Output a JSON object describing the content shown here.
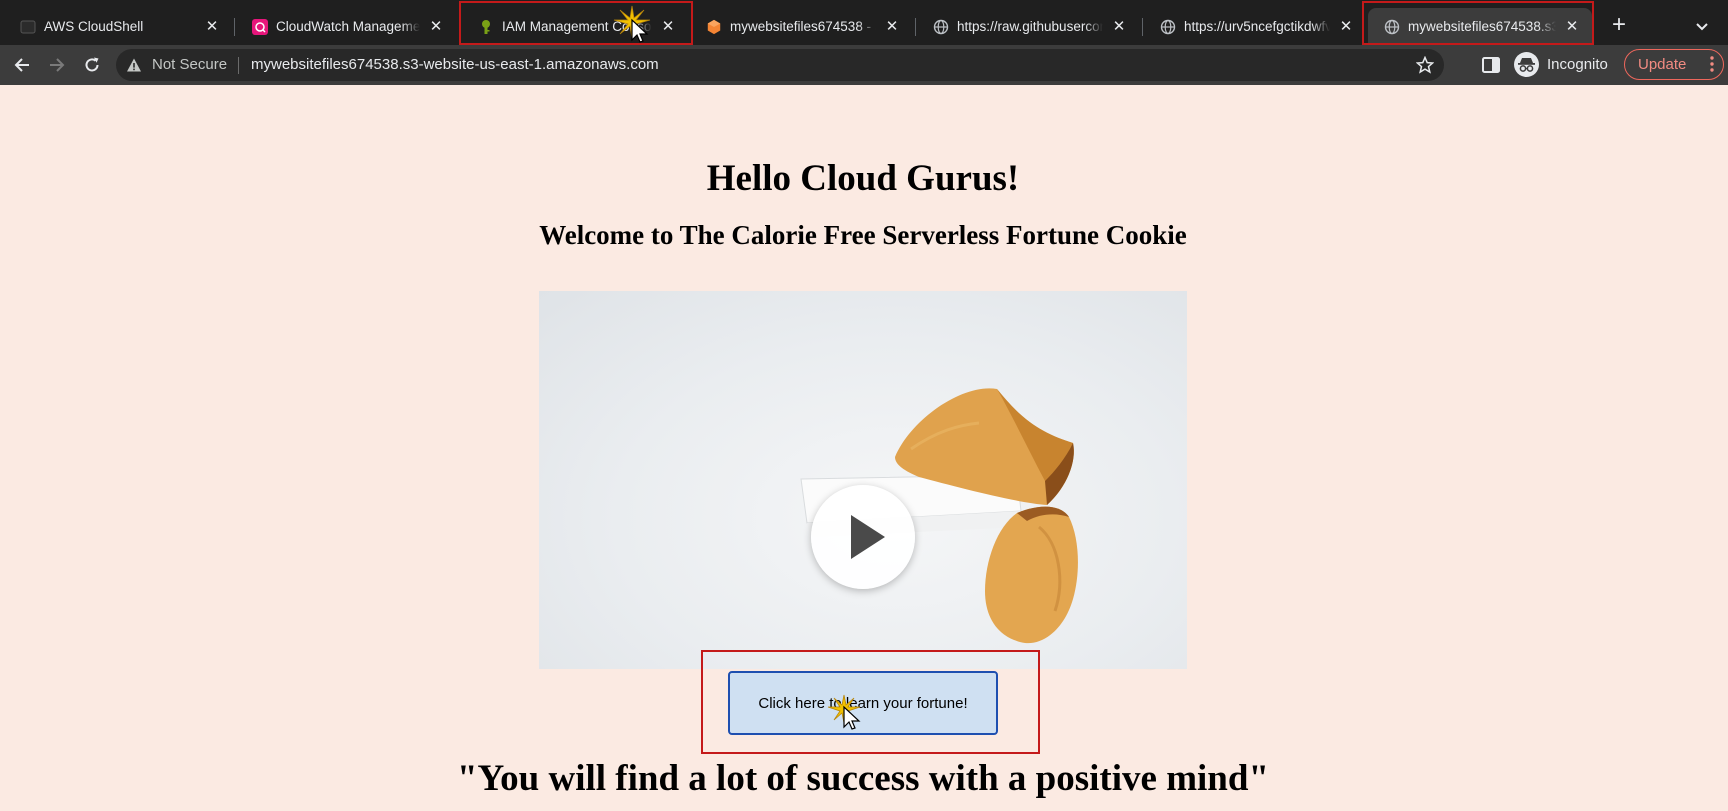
{
  "tabs": [
    {
      "title": "AWS CloudShell",
      "favicon": "cloudshell-icon"
    },
    {
      "title": "CloudWatch Management C",
      "favicon": "cloudwatch-icon"
    },
    {
      "title": "IAM Management Console",
      "favicon": "iam-icon"
    },
    {
      "title": "mywebsitefiles674538 - S3",
      "favicon": "s3-icon"
    },
    {
      "title": "https://raw.githubusercontent",
      "favicon": "globe-icon"
    },
    {
      "title": "https://urv5ncefgctikdwfv",
      "favicon": "globe-icon"
    },
    {
      "title": "mywebsitefiles674538.s3",
      "favicon": "globe-icon",
      "active": true
    }
  ],
  "toolbar": {
    "security_label": "Not Secure",
    "url": "mywebsitefiles674538.s3-website-us-east-1.amazonaws.com",
    "incognito_label": "Incognito",
    "update_label": "Update"
  },
  "page": {
    "heading": "Hello Cloud Gurus!",
    "subheading": "Welcome to The Calorie Free Serverless Fortune Cookie",
    "button_label": "Click here to learn your fortune!",
    "fortune": "\"You will find a lot of success with a positive mind\""
  },
  "colors": {
    "page_background": "#fbeae2",
    "highlight_box": "#c41a1a",
    "button_fill": "#cfe0f2",
    "button_border": "#1e4fb0",
    "update_accent": "#f28b82"
  }
}
